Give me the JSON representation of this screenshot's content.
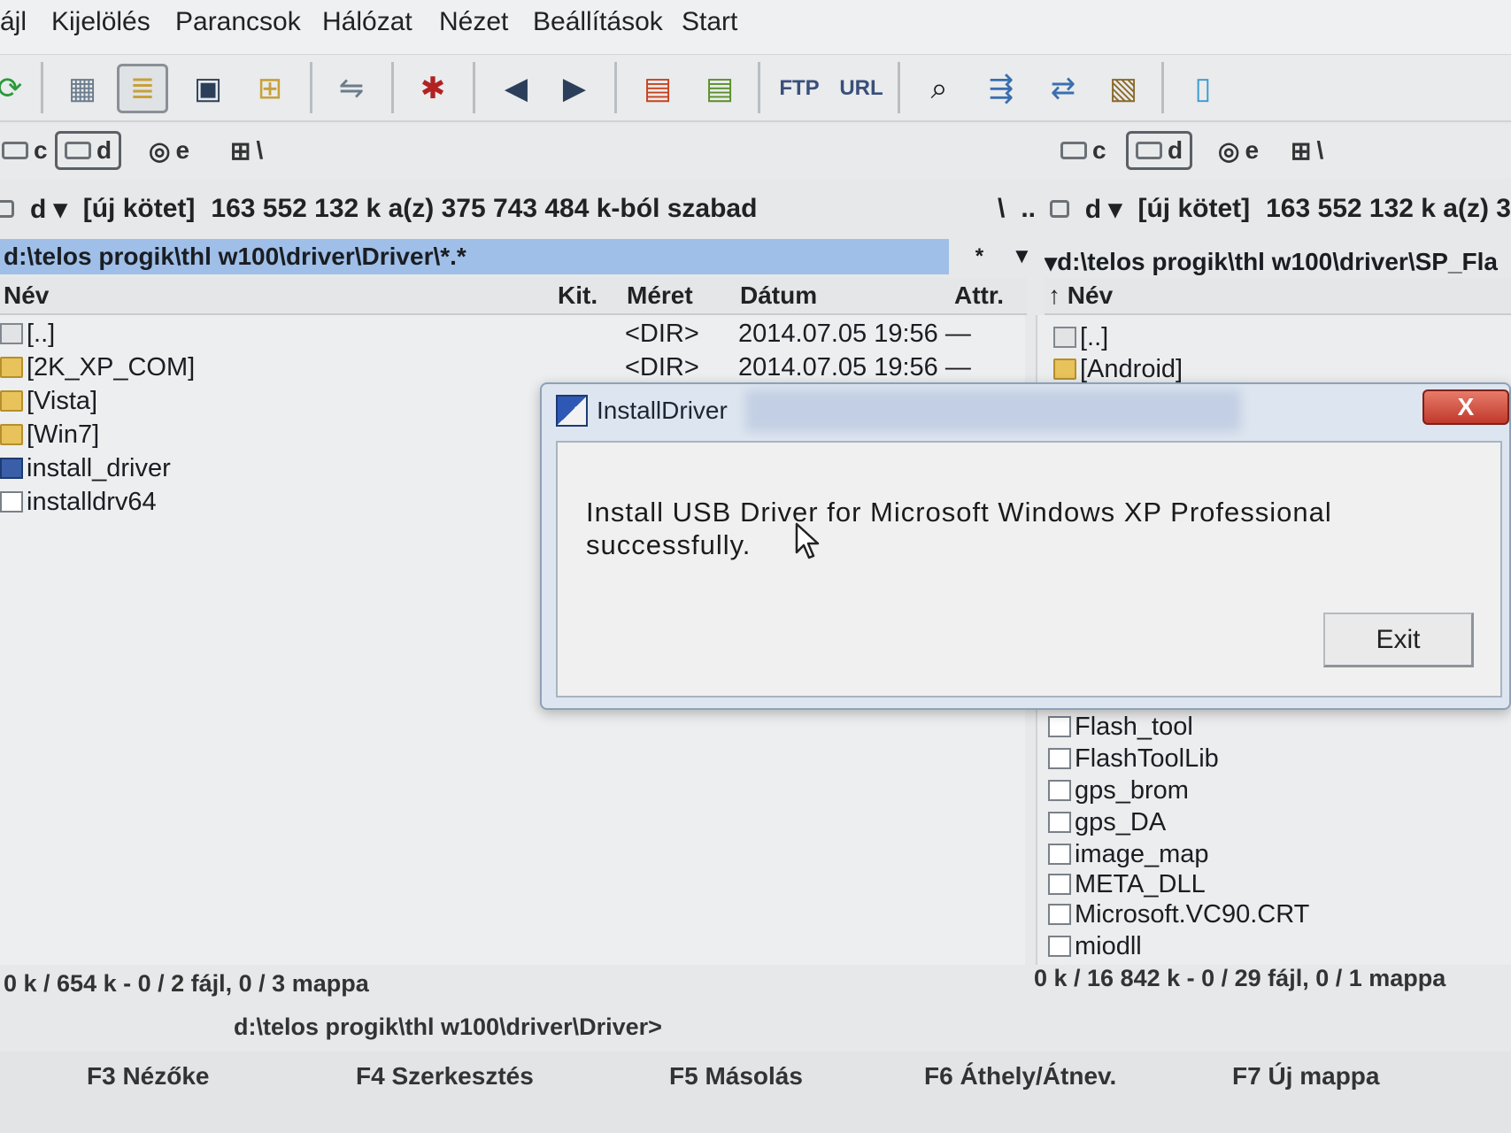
{
  "menu": [
    "ájl",
    "Kijelölés",
    "Parancsok",
    "Hálózat",
    "Nézet",
    "Beállítások",
    "Start"
  ],
  "toolbar": {
    "icons": [
      "refresh-icon",
      "brief-view-icon",
      "full-view-icon",
      "thumbnail-view-icon",
      "tree-view-icon",
      "compare-dirs-icon",
      "pack-icon",
      "back-icon",
      "forward-icon",
      "pack-files-icon",
      "unpack-files-icon",
      "ftp-connect-icon",
      "url-connect-icon",
      "search-binoculars-icon",
      "multi-rename-icon",
      "sync-dirs-icon",
      "copy-clipboard-icon",
      "notepad-icon"
    ]
  },
  "left": {
    "drives": [
      "c",
      "d",
      "e",
      "\\"
    ],
    "drive_select": "d",
    "volume": "[új kötet]",
    "free_space": "163 552 132 k a(z) 375 743 484 k-ból szabad",
    "root_btn": "\\",
    "up_btn": "..",
    "path": "d:\\telos progik\\thl w100\\driver\\Driver\\*.*",
    "filter_star": "*",
    "columns": {
      "name": "Név",
      "ext": "Kit.",
      "size": "Méret",
      "date": "Dátum",
      "attr": "Attr."
    },
    "files": [
      {
        "name": "[..]",
        "size": "<DIR>",
        "date": "2014.07.05 19:56 —",
        "type": "up"
      },
      {
        "name": "[2K_XP_COM]",
        "size": "<DIR>",
        "date": "2014.07.05 19:56 —",
        "type": "folder"
      },
      {
        "name": "[Vista]",
        "size": "",
        "date": "",
        "type": "folder"
      },
      {
        "name": "[Win7]",
        "size": "",
        "date": "",
        "type": "folder"
      },
      {
        "name": "install_driver",
        "size": "",
        "date": "",
        "type": "exe"
      },
      {
        "name": "installdrv64",
        "size": "",
        "date": "",
        "type": "file"
      }
    ],
    "status": "0 k / 654 k - 0 / 2 fájl, 0 / 3 mappa"
  },
  "right": {
    "drives": [
      "c",
      "d",
      "e",
      "\\"
    ],
    "drive_select": "d",
    "volume": "[új kötet]",
    "free_space": "163 552 132 k a(z) 3",
    "path": "d:\\telos progik\\thl w100\\driver\\SP_Fla",
    "columns": {
      "name": "↑ Név"
    },
    "files": [
      {
        "name": "[..]",
        "type": "up"
      },
      {
        "name": "[Android]",
        "type": "folder"
      },
      {
        "name": "Flash_tool",
        "type": "file"
      },
      {
        "name": "FlashToolLib",
        "type": "file"
      },
      {
        "name": "gps_brom",
        "type": "file"
      },
      {
        "name": "gps_DA",
        "type": "file"
      },
      {
        "name": "image_map",
        "type": "file"
      },
      {
        "name": "META_DLL",
        "type": "file"
      },
      {
        "name": "Microsoft.VC90.CRT",
        "type": "file"
      },
      {
        "name": "miodll",
        "type": "file"
      }
    ],
    "status": "0 k / 16 842 k - 0 / 29 fájl, 0 / 1 mappa"
  },
  "cmdline": "d:\\telos progik\\thl w100\\driver\\Driver>",
  "fkeys": [
    "F3 Nézőke",
    "F4 Szerkesztés",
    "F5 Másolás",
    "F6 Áthely/Átnev.",
    "F7 Új mappa"
  ],
  "dialog": {
    "title": "InstallDriver",
    "close": "X",
    "message": "Install USB Driver for Microsoft Windows XP Professional successfully.",
    "exit": "Exit"
  },
  "colors": {
    "selection": "#9fbfe8",
    "close_red": "#c0392b",
    "folder": "#e8c25a"
  }
}
